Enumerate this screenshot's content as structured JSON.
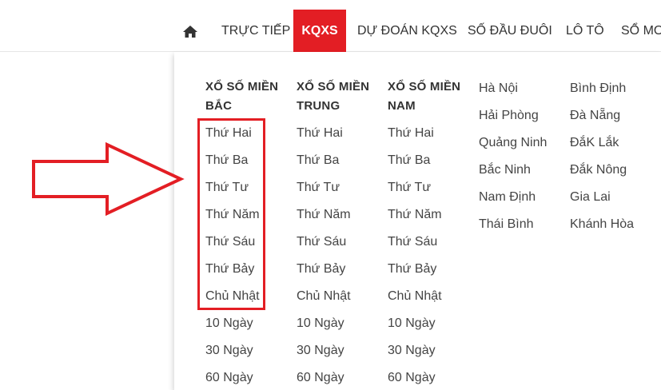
{
  "nav": {
    "home_icon": "home-icon",
    "items": [
      {
        "label": "TRỰC TIẾP"
      },
      {
        "label": "KQXS"
      },
      {
        "label": "DỰ ĐOÁN KQXS"
      },
      {
        "label": "SỐ ĐẦU ĐUÔI"
      },
      {
        "label": "LÔ TÔ"
      },
      {
        "label": "SỔ MƠ"
      }
    ],
    "active_color": "#e31e24"
  },
  "menu": {
    "columns": [
      {
        "title_line1": "XỔ SỐ MIỀN",
        "title_line2": "BẮC",
        "links": [
          "Thứ Hai",
          "Thứ Ba",
          "Thứ Tư",
          "Thứ Năm",
          "Thứ Sáu",
          "Thứ Bảy",
          "Chủ Nhật",
          "10 Ngày",
          "30 Ngày",
          "60 Ngày"
        ]
      },
      {
        "title_line1": "XỔ SỐ MIỀN",
        "title_line2": "TRUNG",
        "links": [
          "Thứ Hai",
          "Thứ Ba",
          "Thứ Tư",
          "Thứ Năm",
          "Thứ Sáu",
          "Thứ Bảy",
          "Chủ Nhật",
          "10 Ngày",
          "30 Ngày",
          "60 Ngày"
        ]
      },
      {
        "title_line1": "XỔ SỐ MIỀN",
        "title_line2": "NAM",
        "links": [
          "Thứ Hai",
          "Thứ Ba",
          "Thứ Tư",
          "Thứ Năm",
          "Thứ Sáu",
          "Thứ Bảy",
          "Chủ Nhật",
          "10 Ngày",
          "30 Ngày",
          "60 Ngày"
        ]
      }
    ],
    "provinces_a": [
      "Hà Nội",
      "Hải Phòng",
      "Quảng Ninh",
      "Bắc Ninh",
      "Nam Định",
      "Thái Bình"
    ],
    "provinces_b": [
      "Bình Định",
      "Đà Nẵng",
      "ĐắK Lắk",
      "Đắk Nông",
      "Gia Lai",
      "Khánh Hòa"
    ]
  },
  "annotation": {
    "color": "#e31e24",
    "arrow_icon": "right-arrow-icon"
  }
}
